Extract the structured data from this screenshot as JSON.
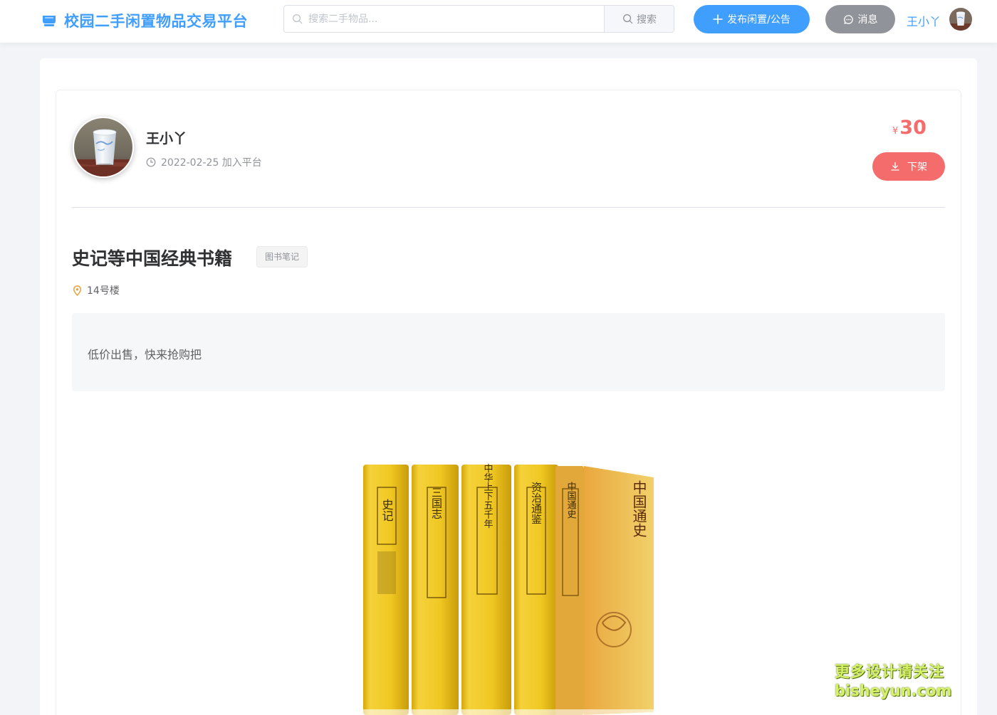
{
  "header": {
    "brand_title": "校园二手闲置物品交易平台",
    "search_placeholder": "搜索二手物品...",
    "search_button_label": "搜索",
    "publish_button_label": "发布闲置/公告",
    "message_button_label": "消息",
    "username": "王小丫"
  },
  "seller": {
    "name": "王小丫",
    "join_date": "2022-02-25 加入平台"
  },
  "item": {
    "price_symbol": "¥",
    "price": "30",
    "takedown_button_label": "下架",
    "title": "史记等中国经典书籍",
    "category": "图书笔记",
    "location": "14号楼",
    "description": "低价出售，快来抢购把"
  },
  "product_image": {
    "book_titles": [
      "史记",
      "三国志",
      "中华上下五千年",
      "资治通鉴",
      "中国通史"
    ],
    "cover_title": "中国通史"
  },
  "watermark": {
    "line1": "更多设计请关注",
    "line2": "bisheyun.com"
  },
  "colors": {
    "primary": "#409eff",
    "danger": "#f56c6c",
    "info": "#909399"
  },
  "icons": {
    "brand": "shop-icon",
    "search": "search-icon",
    "publish": "plus-icon",
    "message": "chat-icon",
    "clock": "clock-icon",
    "takedown": "download-icon",
    "location": "location-pin-icon"
  }
}
